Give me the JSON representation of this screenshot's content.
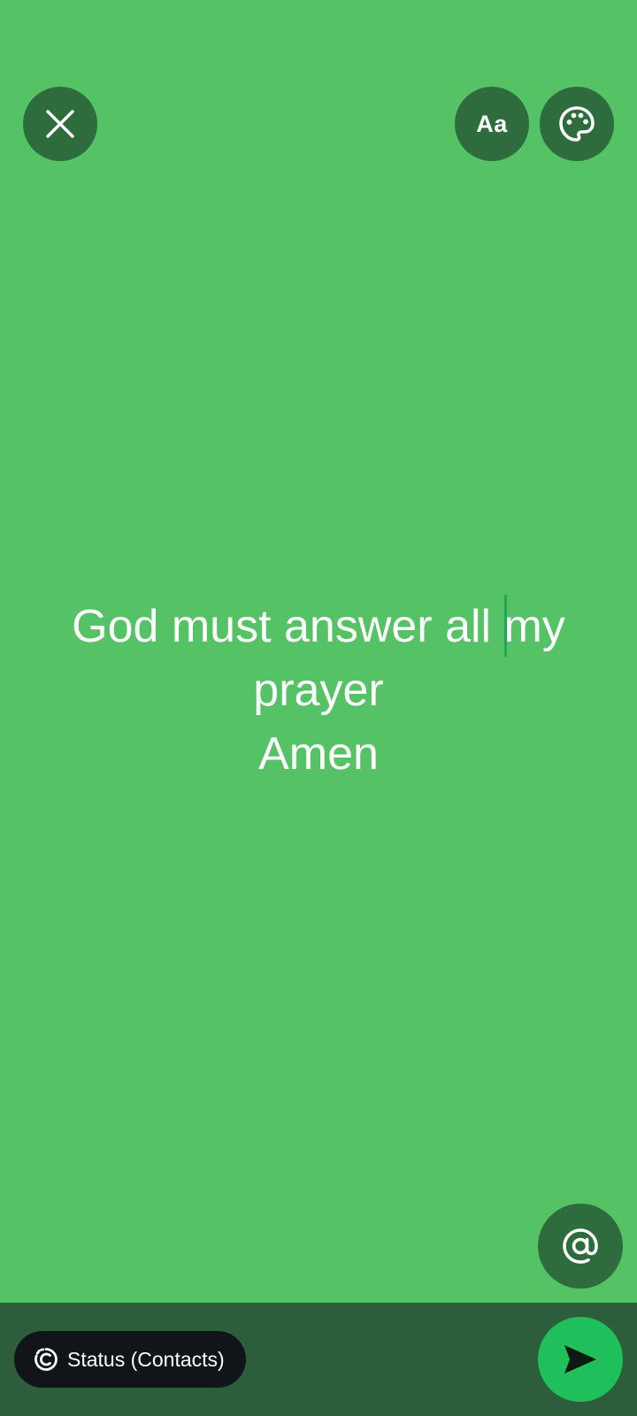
{
  "colors": {
    "background": "#54c265",
    "overlay_button": "#2f6c3d",
    "bottom_bar": "#2d5e3c",
    "pill": "#111418",
    "send_button": "#1fbf5c",
    "text": "#ffffff",
    "cursor": "#1fa855",
    "send_icon": "#0b1a12"
  },
  "toolbar": {
    "close_icon": "close-icon",
    "font_label": "Aa",
    "palette_icon": "palette-icon"
  },
  "status": {
    "text": "God must answer all my\nprayer\nAmen"
  },
  "mention": {
    "icon": "at-sign-icon"
  },
  "audience": {
    "icon": "status-ring-icon",
    "label": "Status (Contacts)"
  },
  "send": {
    "icon": "send-icon"
  }
}
